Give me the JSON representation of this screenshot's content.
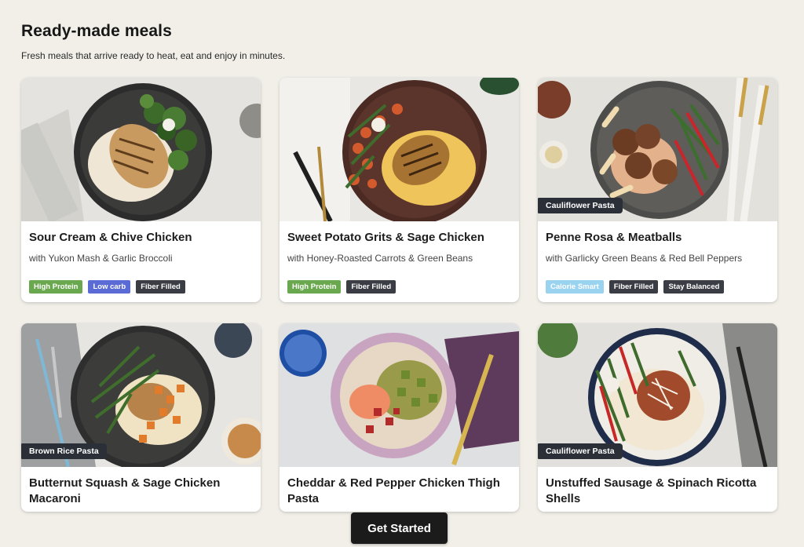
{
  "header": {
    "title": "Ready-made meals",
    "subtitle": "Fresh meals that arrive ready to heat, eat and enjoy in minutes."
  },
  "meals": [
    {
      "title": "Sour Cream & Chive Chicken",
      "description": "with Yukon Mash & Garlic Broccoli",
      "badge": "",
      "tags": [
        {
          "label": "High Protein",
          "color": "#6aa84f"
        },
        {
          "label": "Low carb",
          "color": "#5b6bd5"
        },
        {
          "label": "Fiber Filled",
          "color": "#3a3d44"
        }
      ]
    },
    {
      "title": "Sweet Potato Grits & Sage Chicken",
      "description": "with Honey-Roasted Carrots & Green Beans",
      "badge": "",
      "tags": [
        {
          "label": "High Protein",
          "color": "#6aa84f"
        },
        {
          "label": "Fiber Filled",
          "color": "#3a3d44"
        }
      ]
    },
    {
      "title": "Penne Rosa & Meatballs",
      "description": "with Garlicky Green Beans & Red Bell Peppers",
      "badge": "Cauliflower Pasta",
      "tags": [
        {
          "label": "Calorie Smart",
          "color": "#9ad3f0"
        },
        {
          "label": "Fiber Filled",
          "color": "#3a3d44"
        },
        {
          "label": "Stay Balanced",
          "color": "#3a3d44"
        }
      ]
    },
    {
      "title": "Butternut Squash & Sage Chicken Macaroni",
      "description": "",
      "badge": "Brown Rice Pasta",
      "tags": []
    },
    {
      "title": "Cheddar & Red Pepper Chicken Thigh Pasta",
      "description": "",
      "badge": "",
      "tags": []
    },
    {
      "title": "Unstuffed Sausage & Spinach Ricotta Shells",
      "description": "",
      "badge": "Cauliflower Pasta",
      "tags": []
    }
  ],
  "cta": {
    "label": "Get Started"
  }
}
